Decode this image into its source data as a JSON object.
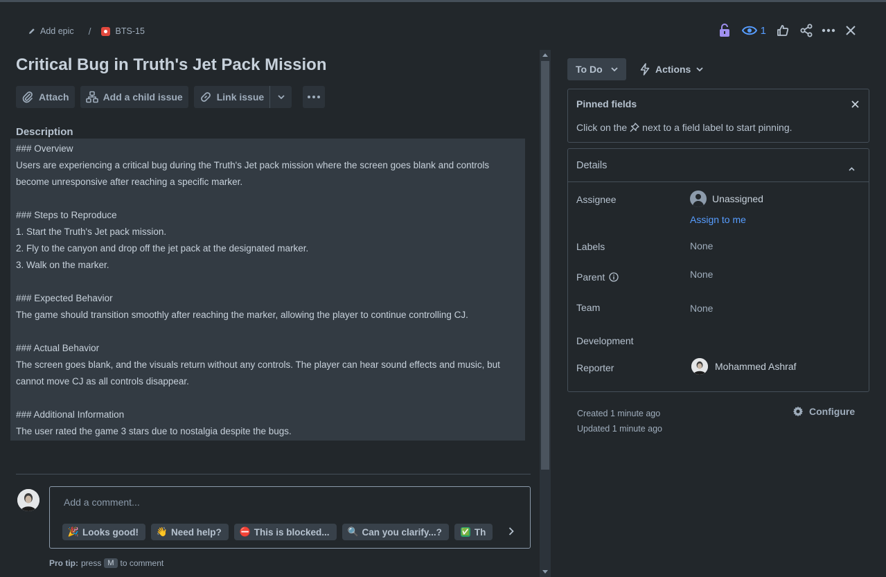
{
  "breadcrumb": {
    "epic_label": "Add epic",
    "separator": "/",
    "issue_key": "BTS-15"
  },
  "header": {
    "watch_count": "1"
  },
  "issue": {
    "title": "Critical Bug in Truth's Jet Pack Mission",
    "toolbar": {
      "attach": "Attach",
      "add_child": "Add a child issue",
      "link_issue": "Link issue"
    },
    "description_heading": "Description",
    "description_lines": [
      "### Overview",
      "Users are experiencing a critical bug during the Truth's Jet pack mission where the screen goes blank and controls",
      "become unresponsive after reaching a specific marker.",
      "",
      "### Steps to Reproduce",
      "1. Start the Truth's Jet pack mission.",
      "2. Fly to the canyon and drop off the jet pack at the designated marker.",
      "3. Walk on the marker.",
      "",
      "### Expected Behavior",
      "The game should transition smoothly after reaching the marker, allowing the player to continue controlling CJ.",
      "",
      "### Actual Behavior",
      "The screen goes blank, and the visuals return without any controls. The player can hear sound effects and music, but",
      "cannot move CJ as all controls disappear.",
      "",
      "### Additional Information",
      "The user rated the game 3 stars due to nostalgia despite the bugs."
    ]
  },
  "comment": {
    "placeholder": "Add a comment...",
    "quick_replies": [
      {
        "emoji": "🎉",
        "label": "Looks good!"
      },
      {
        "emoji": "👋",
        "label": "Need help?"
      },
      {
        "emoji": "⛔",
        "label": "This is blocked..."
      },
      {
        "emoji": "🔍",
        "label": "Can you clarify...?"
      },
      {
        "emoji": "✅",
        "label": "Th"
      }
    ],
    "protip_bold": "Pro tip:",
    "protip_press": "press",
    "protip_key": "M",
    "protip_rest": "to comment"
  },
  "sidebar": {
    "status": "To Do",
    "actions": "Actions",
    "pinned": {
      "title": "Pinned fields",
      "text_before": "Click on the",
      "text_after": "next to a field label to start pinning."
    },
    "details": {
      "title": "Details",
      "assignee_label": "Assignee",
      "assignee_value": "Unassigned",
      "assign_to_me": "Assign to me",
      "labels_label": "Labels",
      "labels_value": "None",
      "parent_label": "Parent",
      "parent_value": "None",
      "team_label": "Team",
      "team_value": "None",
      "development_label": "Development",
      "reporter_label": "Reporter",
      "reporter_value": "Mohammed Ashraf"
    },
    "created": "Created 1 minute ago",
    "updated": "Updated 1 minute ago",
    "configure": "Configure"
  },
  "colors": {
    "background": "#22272b",
    "accent": "#579dff",
    "lock": "#9f8fef",
    "bug": "#e2483d"
  }
}
